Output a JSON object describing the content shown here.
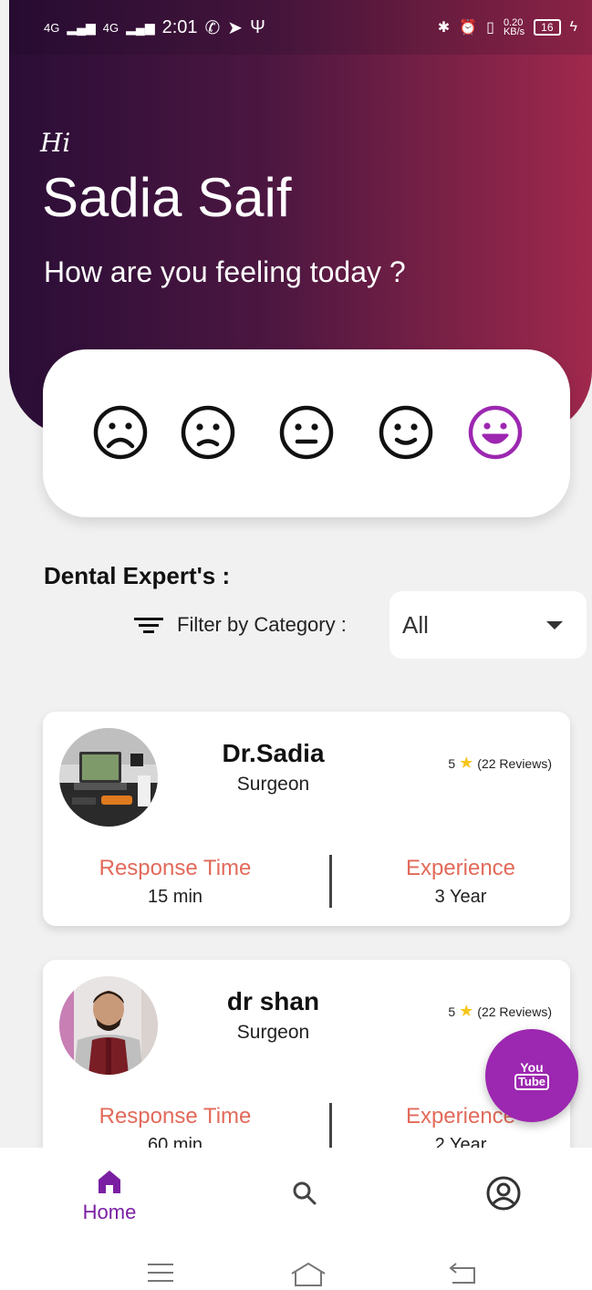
{
  "status_bar": {
    "network1": "4G",
    "network2": "4G",
    "time": "2:01",
    "speed_value": "0.20",
    "speed_unit": "KB/s",
    "battery": "16"
  },
  "greeting": {
    "hi": "Hi",
    "name": "Sadia Saif",
    "question": "How are you feeling today ?"
  },
  "moods": [
    "very-sad-icon",
    "sad-icon",
    "neutral-icon",
    "slightly-happy-icon",
    "happy-icon"
  ],
  "selected_mood_color": "#9c27b0",
  "section_title": "Dental Expert's :",
  "filter": {
    "label": "Filter by Category :",
    "selected": "All"
  },
  "doctors": [
    {
      "name": "Dr.Sadia",
      "specialty": "Surgeon",
      "rating": "5",
      "reviews": "(22 Reviews)",
      "response_label": "Response Time",
      "response_value": "15 min",
      "experience_label": "Experience",
      "experience_value": "3 Year"
    },
    {
      "name": "dr shan",
      "specialty": "Surgeon",
      "rating": "5",
      "reviews": "(22 Reviews)",
      "response_label": "Response Time",
      "response_value": "60 min",
      "experience_label": "Experience",
      "experience_value": "2 Year"
    }
  ],
  "fab": {
    "line1": "You",
    "line2": "Tube"
  },
  "bottom_nav": {
    "home_label": "Home",
    "active_color": "#7b1fa2"
  }
}
